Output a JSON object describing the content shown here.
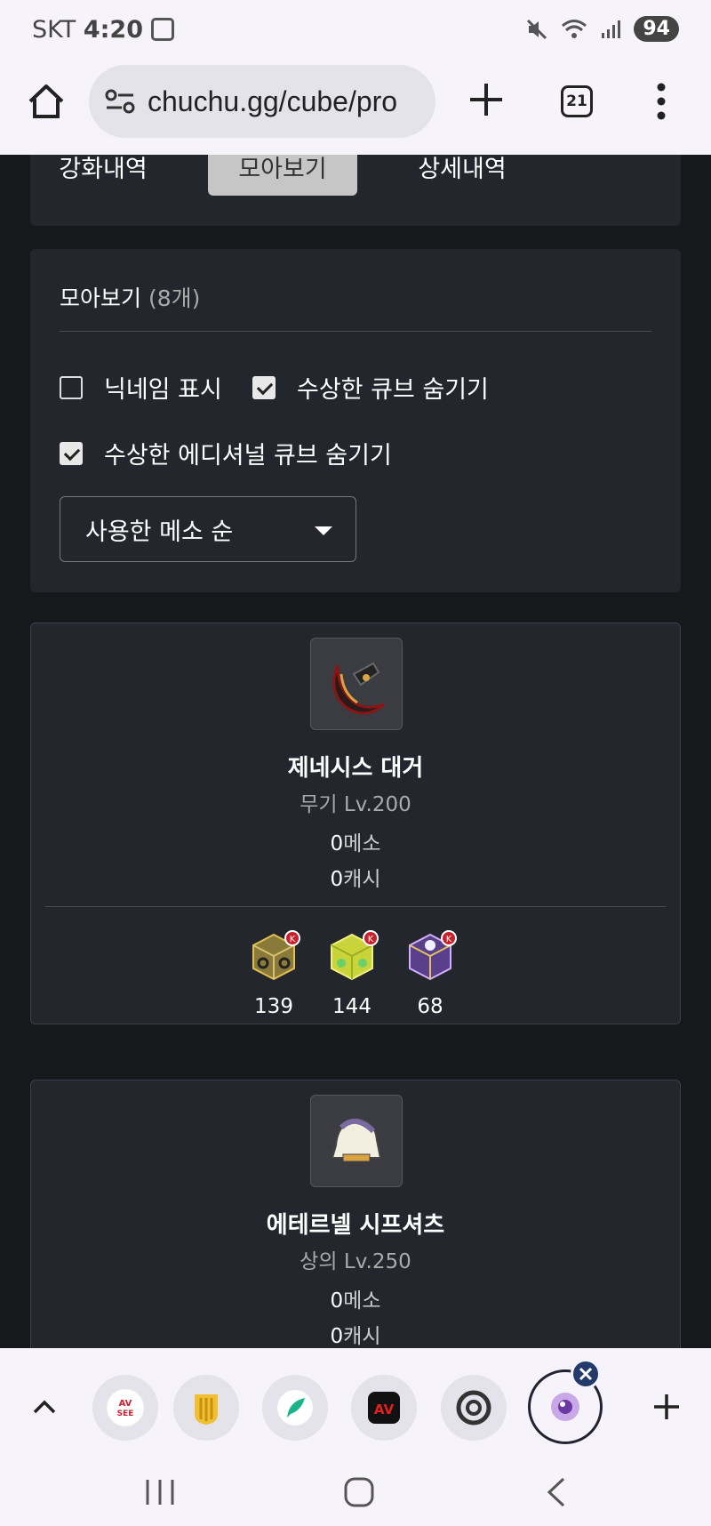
{
  "status_bar": {
    "carrier": "SKT",
    "time": "4:20",
    "battery": "94"
  },
  "browser": {
    "url": "chuchu.gg/cube/pro",
    "tab_count": "21"
  },
  "tabs": [
    {
      "label": "강화내역",
      "active": false
    },
    {
      "label": "모아보기",
      "active": true
    },
    {
      "label": "상세내역",
      "active": false
    }
  ],
  "filter": {
    "title": "모아보기",
    "count": "(8개)",
    "options": [
      {
        "label": "닉네임 표시",
        "checked": false
      },
      {
        "label": "수상한 큐브 숨기기",
        "checked": true
      },
      {
        "label": "수상한 에디셔널 큐브 숨기기",
        "checked": true
      }
    ],
    "sort_selected": "사용한 메소 순"
  },
  "items": [
    {
      "name": "제네시스 대거",
      "type": "무기 Lv.200",
      "meso_value": "0",
      "meso_unit": "메소",
      "cash_value": "0",
      "cash_unit": "캐시",
      "cubes": [
        {
          "icon": "red-cube-icon",
          "count": "139"
        },
        {
          "icon": "additional-cube-icon",
          "count": "144"
        },
        {
          "icon": "black-cube-icon",
          "count": "68"
        }
      ]
    },
    {
      "name": "에테르넬 시프셔츠",
      "type": "상의 Lv.250",
      "meso_value": "0",
      "meso_unit": "메소",
      "cash_value": "0",
      "cash_unit": "캐시"
    }
  ],
  "dock": {
    "apps": [
      {
        "icon": "avsee-app-icon",
        "label": "AV SEE"
      },
      {
        "icon": "shield-app-icon"
      },
      {
        "icon": "feather-app-icon"
      },
      {
        "icon": "av-app-icon",
        "label": "AV"
      },
      {
        "icon": "chrome-app-icon"
      },
      {
        "icon": "camera-app-icon"
      }
    ]
  }
}
